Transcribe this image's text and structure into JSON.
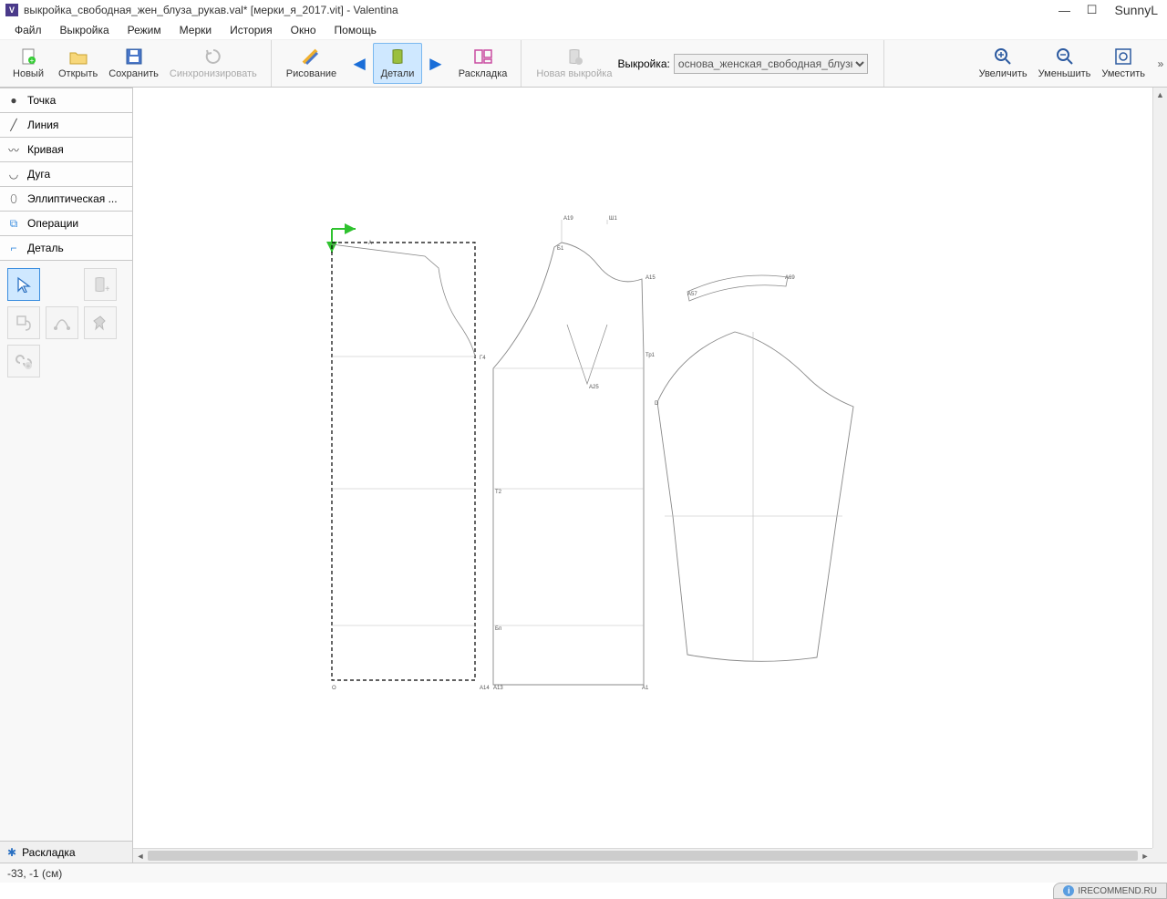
{
  "title": "выкройка_свободная_жен_блуза_рукав.val* [мерки_я_2017.vit] - Valentina",
  "user": "SunnyL",
  "menu": {
    "file": "Файл",
    "pattern": "Выкройка",
    "mode": "Режим",
    "measurements": "Мерки",
    "history": "История",
    "window": "Окно",
    "help": "Помощь"
  },
  "toolbar": {
    "new": "Новый",
    "open": "Открыть",
    "save": "Сохранить",
    "sync": "Синхронизировать",
    "drawing": "Рисование",
    "details": "Детали",
    "layout": "Раскладка",
    "new_pattern": "Новая выкройка",
    "pattern_label": "Выкройка:",
    "pattern_value": "основа_женская_свободная_блузка",
    "zoom_in": "Увеличить",
    "zoom_out": "Уменьшить",
    "fit": "Уместить"
  },
  "sidebar": {
    "cats": {
      "point": "Точка",
      "line": "Линия",
      "curve": "Кривая",
      "arc": "Дуга",
      "elliptical": "Эллиптическая ...",
      "operations": "Операции",
      "detail": "Деталь"
    },
    "dock_tab": "Раскладка"
  },
  "canvas": {
    "labels": {
      "A": "А",
      "A1": "А1",
      "A13": "А13",
      "A14": "А14",
      "A15": "А15",
      "A19": "А19",
      "A25": "А25",
      "A57": "А57",
      "A69": "А69",
      "Sh1": "Ш1",
      "Tp1": "Тр1",
      "G4": "Г4",
      "T2": "Т2",
      "Bn": "Бп",
      "B1": "Б1",
      "O": "О",
      "D": "D"
    }
  },
  "status": "-33, -1 (см)",
  "watermark": "IRECOMMEND.RU"
}
